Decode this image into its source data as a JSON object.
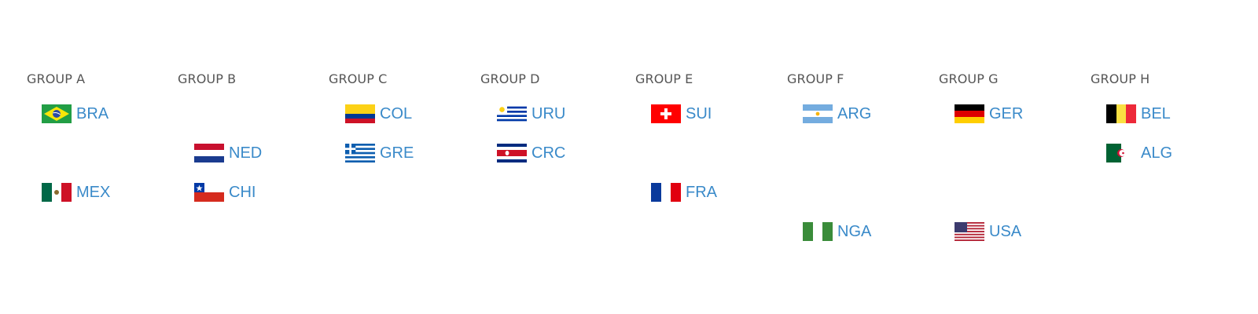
{
  "groups": [
    {
      "label": "GROUP A",
      "teams": [
        {
          "code": "BRA",
          "flag": "brazil-flag-icon"
        },
        {
          "code": "MEX",
          "flag": "mexico-flag-icon"
        }
      ]
    },
    {
      "label": "GROUP B",
      "teams": [
        {
          "code": "NED",
          "flag": "netherlands-flag-icon"
        },
        {
          "code": "CHI",
          "flag": "chile-flag-icon"
        }
      ]
    },
    {
      "label": "GROUP C",
      "teams": [
        {
          "code": "COL",
          "flag": "colombia-flag-icon"
        },
        {
          "code": "GRE",
          "flag": "greece-flag-icon"
        }
      ]
    },
    {
      "label": "GROUP D",
      "teams": [
        {
          "code": "URU",
          "flag": "uruguay-flag-icon"
        },
        {
          "code": "CRC",
          "flag": "costa-rica-flag-icon"
        }
      ]
    },
    {
      "label": "GROUP E",
      "teams": [
        {
          "code": "SUI",
          "flag": "switzerland-flag-icon"
        },
        {
          "code": "FRA",
          "flag": "france-flag-icon"
        }
      ]
    },
    {
      "label": "GROUP F",
      "teams": [
        {
          "code": "ARG",
          "flag": "argentina-flag-icon"
        },
        {
          "code": "NGA",
          "flag": "nigeria-flag-icon"
        }
      ]
    },
    {
      "label": "GROUP G",
      "teams": [
        {
          "code": "GER",
          "flag": "germany-flag-icon"
        },
        {
          "code": "USA",
          "flag": "usa-flag-icon"
        }
      ]
    },
    {
      "label": "GROUP H",
      "teams": [
        {
          "code": "BEL",
          "flag": "belgium-flag-icon"
        },
        {
          "code": "ALG",
          "flag": "algeria-flag-icon"
        }
      ]
    }
  ],
  "colors": {
    "team_link": "#3a8ac9",
    "group_label": "#555555"
  }
}
